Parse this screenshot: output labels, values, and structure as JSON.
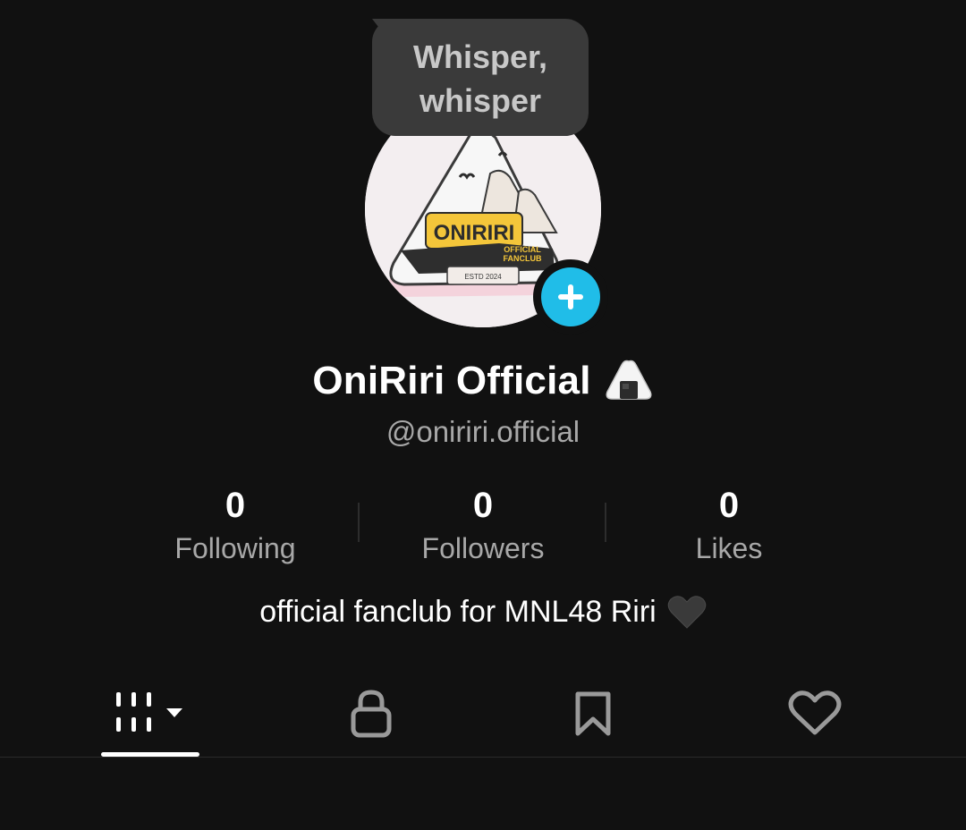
{
  "tooltip": {
    "line1": "Whisper,",
    "line2": "whisper"
  },
  "profile": {
    "display_name": "OniRiri Official",
    "name_emoji": "rice-ball-emoji",
    "handle": "@oniriri.official",
    "avatar_text": "ONIRIRI",
    "avatar_subtext_1": "OFFICIAL",
    "avatar_subtext_2": "FANCLUB",
    "avatar_estd": "ESTD 2024"
  },
  "stats": [
    {
      "value": "0",
      "label": "Following"
    },
    {
      "value": "0",
      "label": "Followers"
    },
    {
      "value": "0",
      "label": "Likes"
    }
  ],
  "bio": {
    "text": "official fanclub for MNL48 Riri",
    "emoji": "black-heart-emoji"
  },
  "tabs": [
    {
      "icon": "grid-icon",
      "active": true
    },
    {
      "icon": "lock-icon",
      "active": false
    },
    {
      "icon": "bookmark-icon",
      "active": false
    },
    {
      "icon": "heart-icon",
      "active": false
    }
  ],
  "colors": {
    "background": "#111111",
    "accent": "#20bde8",
    "secondary_text": "#a8a8a8",
    "tooltip_bg": "#3a3a3a"
  }
}
